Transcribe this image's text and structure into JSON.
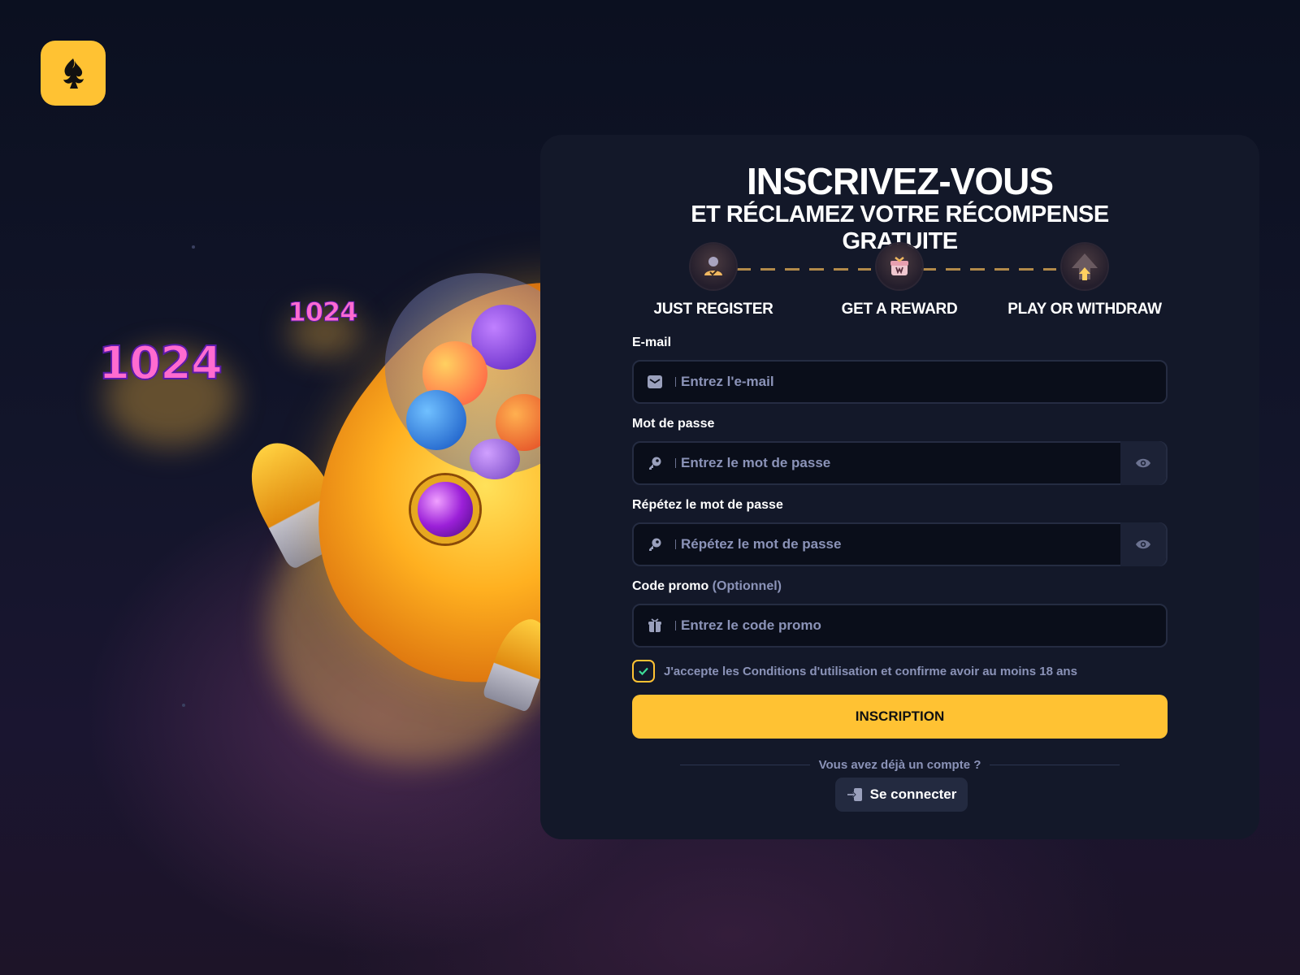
{
  "brand": {
    "accent": "#ffc233",
    "logo_icon": "spade-flame-icon"
  },
  "artwork": {
    "badge_text": "1024"
  },
  "form": {
    "title": "INSCRIVEZ-VOUS",
    "subtitle": "ET RÉCLAMEZ VOTRE RÉCOMPENSE GRATUITE",
    "steps": [
      {
        "label": "JUST REGISTER",
        "icon": "user-check-icon"
      },
      {
        "label": "GET A REWARD",
        "icon": "gift-icon"
      },
      {
        "label": "PLAY OR WITHDRAW",
        "icon": "arrow-up-icon"
      }
    ],
    "email": {
      "label": "E-mail",
      "placeholder": "Entrez l'e-mail"
    },
    "password": {
      "label": "Mot de passe",
      "placeholder": "Entrez le mot de passe"
    },
    "password_repeat": {
      "label": "Répétez le mot de passe",
      "placeholder": "Répétez le mot de passe"
    },
    "promo": {
      "label": "Code promo",
      "optional": "(Optionnel)",
      "placeholder": "Entrez le code promo"
    },
    "terms": {
      "text": "J'accepte les Conditions d'utilisation et confirme avoir au moins 18 ans",
      "checked": true
    },
    "submit_label": "INSCRIPTION",
    "have_account": "Vous avez déjà un compte ?",
    "login_label": "Se connecter"
  }
}
